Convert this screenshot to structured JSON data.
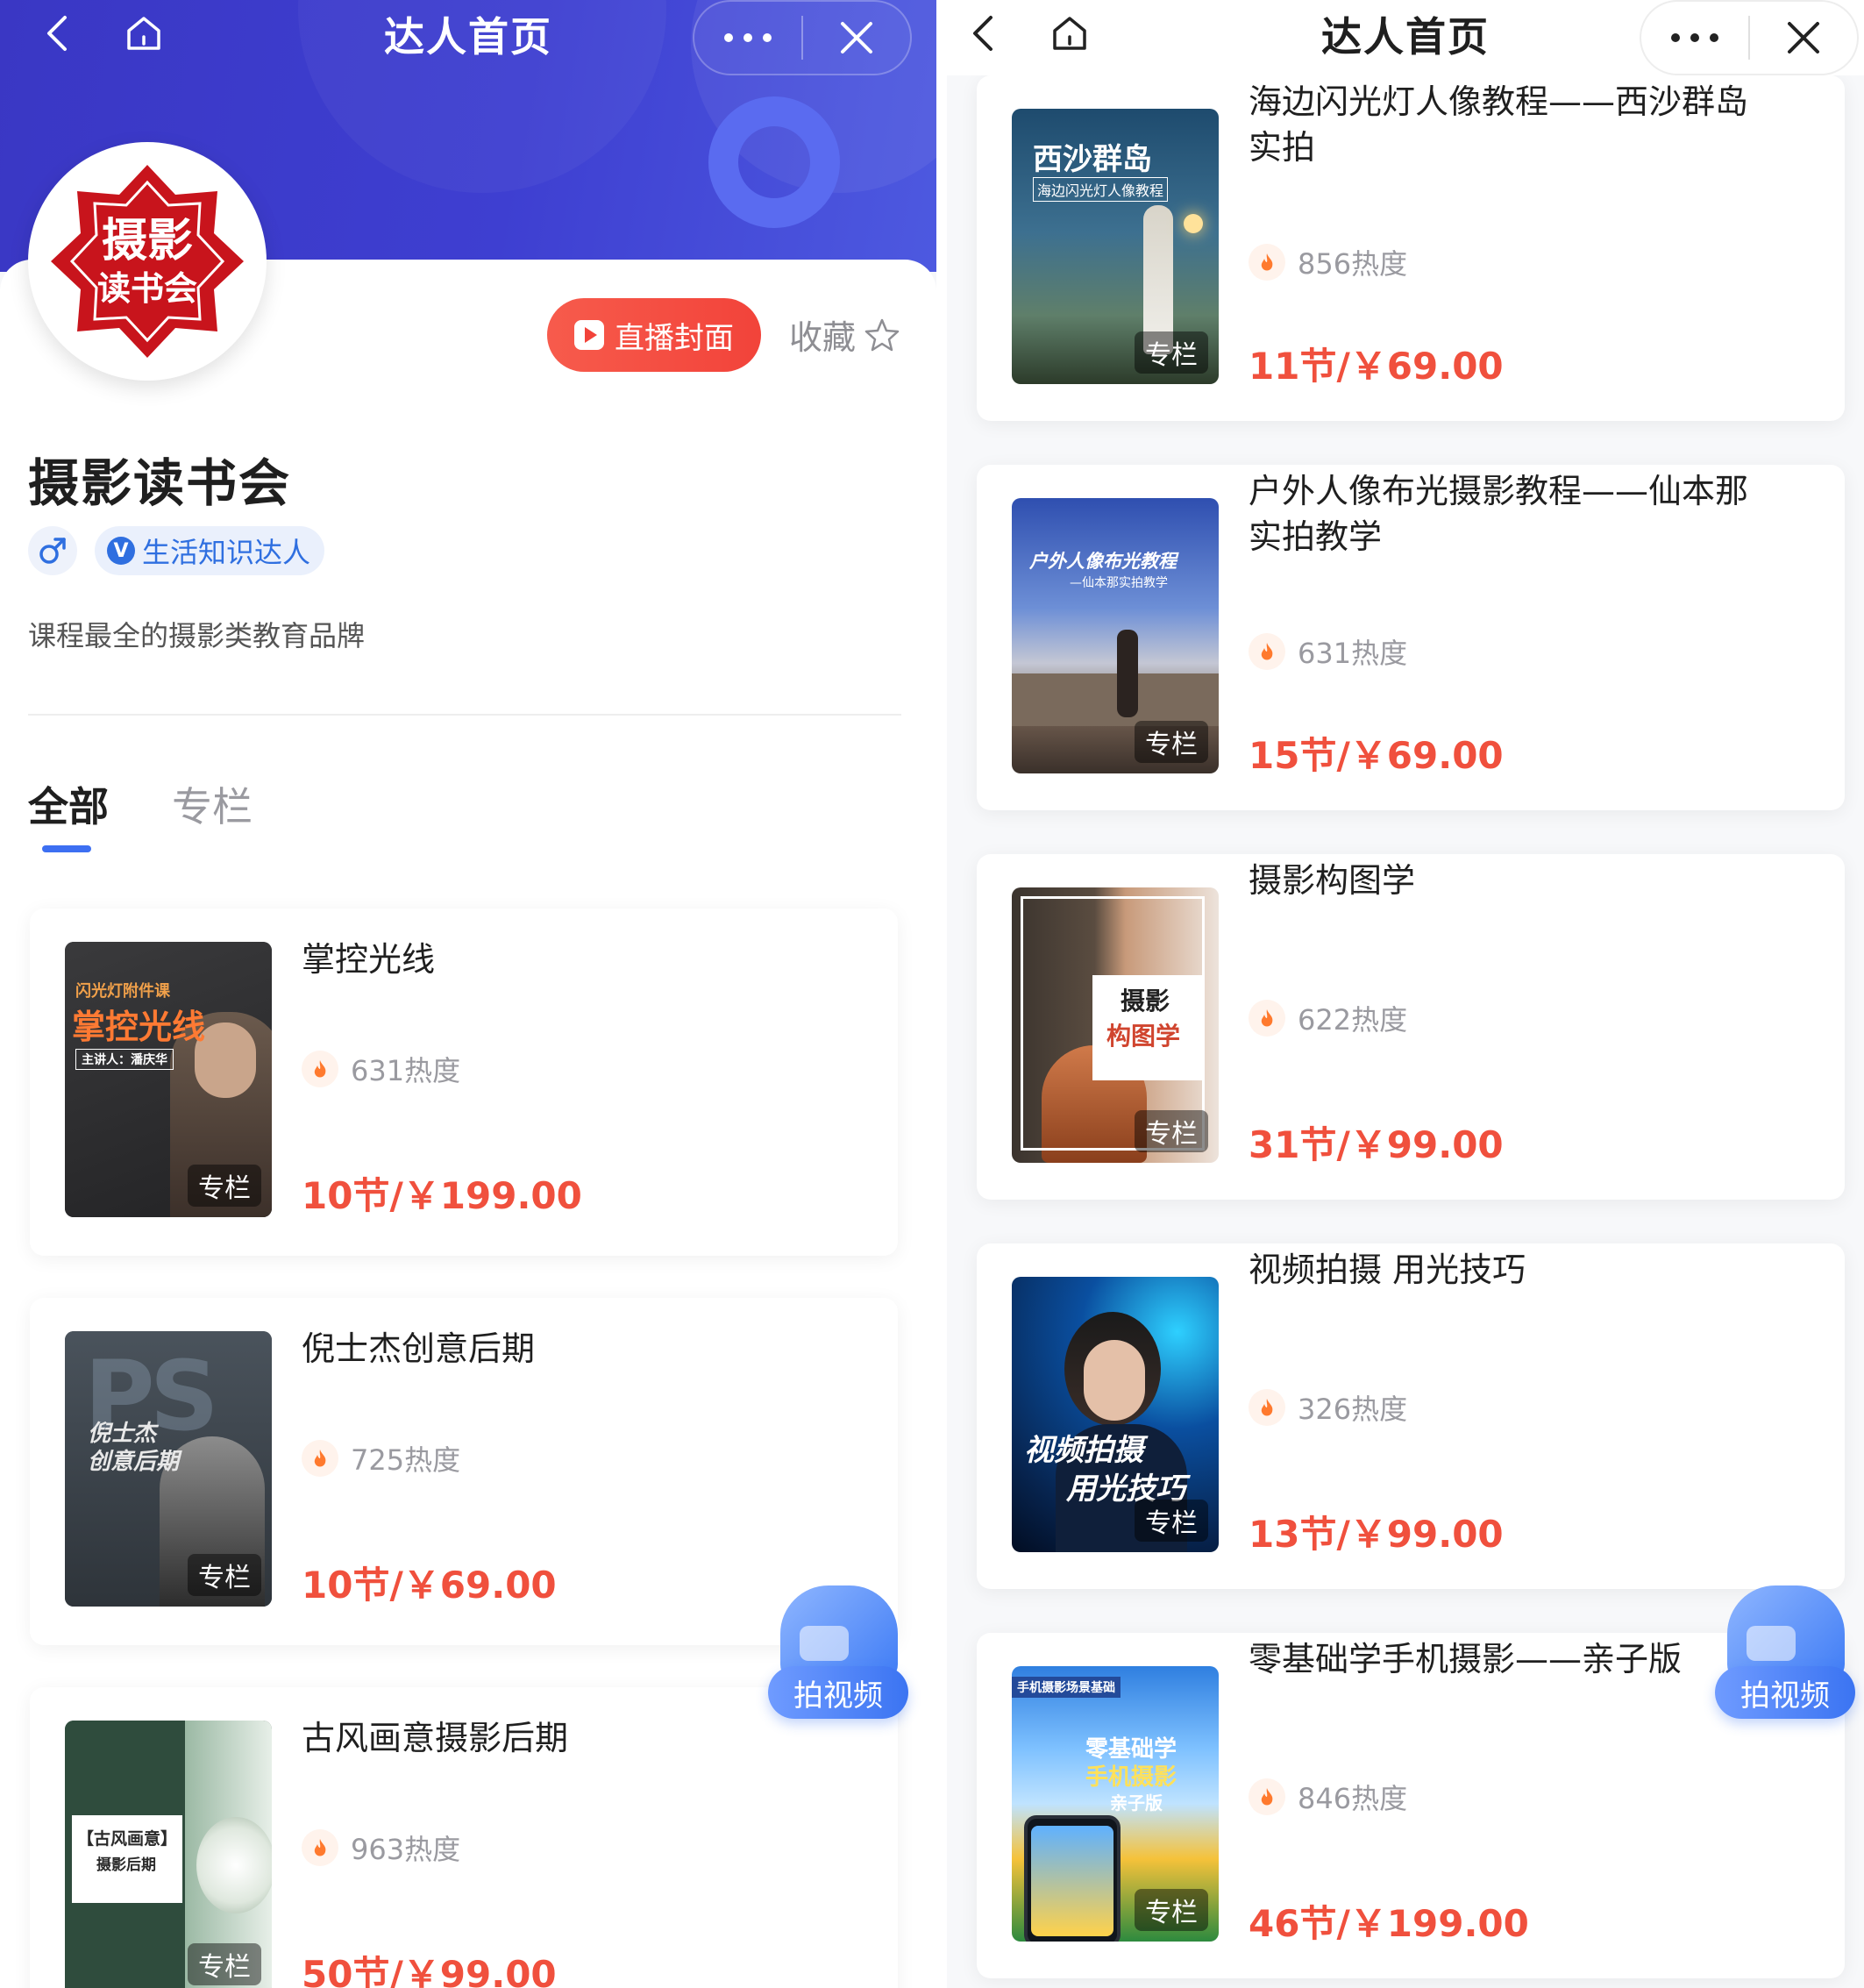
{
  "left": {
    "nav": {
      "title": "达人首页"
    },
    "profile": {
      "live_button": "直播封面",
      "favorite_label": "收藏",
      "name": "摄影读书会",
      "avatar_text_line1": "摄影",
      "avatar_text_line2": "读书会",
      "badge": "生活知识达人",
      "badge_v": "V",
      "description": "课程最全的摄影类教育品牌"
    },
    "tabs": [
      {
        "label": "全部",
        "active": true
      },
      {
        "label": "专栏",
        "active": false
      }
    ],
    "courses": [
      {
        "title": "掌控光线",
        "heat": "631热度",
        "price": "10节/￥199.00",
        "tag": "专栏",
        "cover": {
          "line1": "闪光灯附件课",
          "line2": "掌控光线",
          "line3": "主讲人：潘庆华"
        }
      },
      {
        "title": "倪士杰创意后期",
        "heat": "725热度",
        "price": "10节/￥69.00",
        "tag": "专栏",
        "cover": {
          "line1": "倪士杰",
          "line2": "创意后期",
          "line3": "PS"
        }
      },
      {
        "title": "古风画意摄影后期",
        "heat": "963热度",
        "price": "50节/￥99.00",
        "tag": "专栏",
        "cover": {
          "line1": "【古风画意】",
          "line2": "摄影后期"
        }
      }
    ],
    "shoot_button": "拍视频"
  },
  "right": {
    "nav": {
      "title": "达人首页"
    },
    "courses": [
      {
        "title": "海边闪光灯人像教程——西沙群岛实拍",
        "title_line1": "海边闪光灯人像教程——西沙群岛",
        "title_line2": "实拍",
        "heat": "856热度",
        "price": "11节/￥69.00",
        "tag": "专栏",
        "cover": {
          "line1": "西沙群岛",
          "line2": "海边闪光灯人像教程"
        }
      },
      {
        "title": "户外人像布光摄影教程——仙本那实拍教学",
        "title_line1": "户外人像布光摄影教程——仙本那",
        "title_line2": "实拍教学",
        "heat": "631热度",
        "price": "15节/￥69.00",
        "tag": "专栏",
        "cover": {
          "line1": "户外人像布光教程",
          "line2": "—仙本那实拍教学"
        }
      },
      {
        "title": "摄影构图学",
        "title_line1": "摄影构图学",
        "title_line2": "",
        "heat": "622热度",
        "price": "31节/￥99.00",
        "tag": "专栏",
        "cover": {
          "line1": "摄影",
          "line2": "构图学"
        }
      },
      {
        "title": "视频拍摄 用光技巧",
        "title_line1": "视频拍摄 用光技巧",
        "title_line2": "",
        "heat": "326热度",
        "price": "13节/￥99.00",
        "tag": "专栏",
        "cover": {
          "line1": "视频拍摄",
          "line2": "用光技巧"
        }
      },
      {
        "title": "零基础学手机摄影——亲子版",
        "title_line1": "零基础学手机摄影——亲子版",
        "title_line2": "",
        "heat": "846热度",
        "price": "46节/￥199.00",
        "tag": "专栏",
        "cover": {
          "line1": "零基础学",
          "line2": "手机摄影",
          "line3": "亲子版",
          "top": "手机摄影场景基础"
        }
      }
    ],
    "shoot_button": "拍视频"
  },
  "colors": {
    "accent_blue": "#3d6ff2",
    "price_red": "#f0503d",
    "hero_purple": "#3a37c4",
    "live_red": "#f2433a"
  },
  "icons": [
    "back-arrow-icon",
    "home-icon",
    "more-icon",
    "close-icon",
    "play-icon",
    "star-icon",
    "male-icon",
    "verified-icon",
    "flame-icon",
    "camera-icon"
  ]
}
